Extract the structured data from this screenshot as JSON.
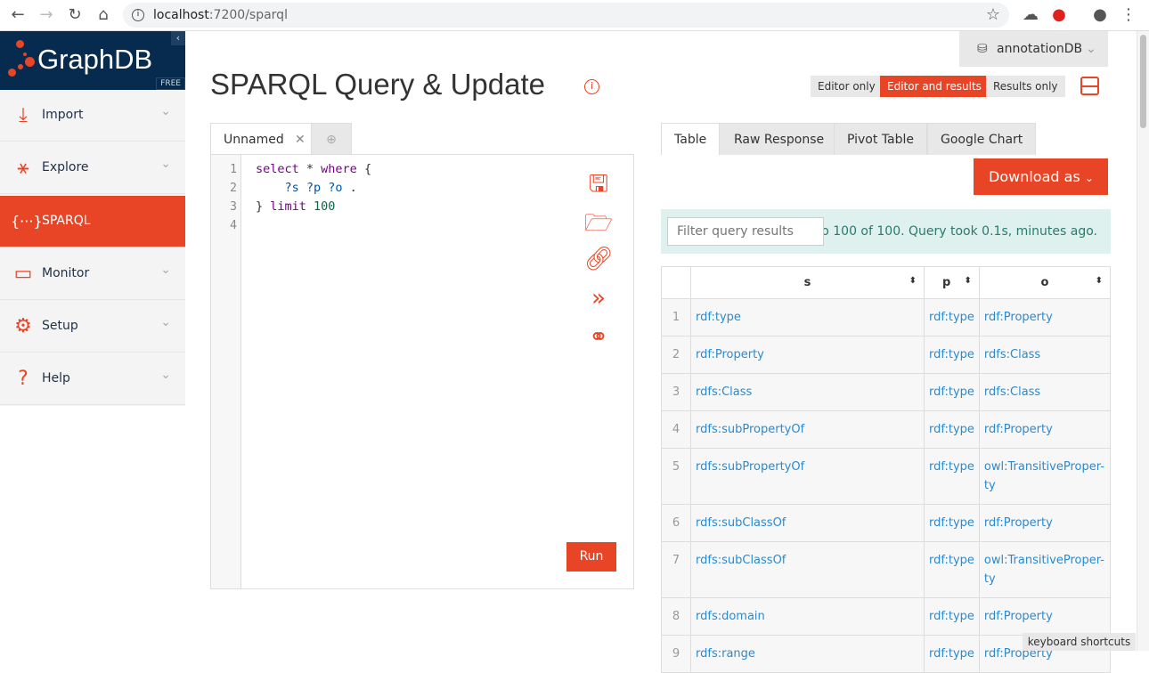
{
  "browser": {
    "url_host": "localhost",
    "url_path": ":7200/sparql"
  },
  "sidebar": {
    "logo": "GraphDB",
    "edition": "FREE",
    "items": [
      {
        "label": "Import",
        "icon": "import-icon"
      },
      {
        "label": "Explore",
        "icon": "explore-icon"
      },
      {
        "label": "SPARQL",
        "icon": "sparql-icon"
      },
      {
        "label": "Monitor",
        "icon": "monitor-icon"
      },
      {
        "label": "Setup",
        "icon": "gear-icon"
      },
      {
        "label": "Help",
        "icon": "help-icon"
      }
    ]
  },
  "header": {
    "title": "SPARQL Query & Update",
    "repository": "annotationDB",
    "modes": [
      "Editor only",
      "Editor and results",
      "Results only"
    ]
  },
  "editor": {
    "tab": "Unnamed",
    "line_numbers": [
      "1",
      "2",
      "3",
      "4"
    ],
    "run_label": "Run"
  },
  "results": {
    "tabs": [
      "Table",
      "Raw Response",
      "Pivot Table",
      "Google Chart"
    ],
    "download_label": "Download as",
    "filter_placeholder": "Filter query results",
    "status": "rom 1 to 100 of 100. Query took 0.1s, minutes ago.",
    "columns": [
      "s",
      "p",
      "o"
    ],
    "rows": [
      [
        "1",
        "rdf:type",
        "rdf:type",
        "rdf:Property"
      ],
      [
        "2",
        "rdf:Property",
        "rdf:type",
        "rdfs:Class"
      ],
      [
        "3",
        "rdfs:Class",
        "rdf:type",
        "rdfs:Class"
      ],
      [
        "4",
        "rdfs:subPropertyOf",
        "rdf:type",
        "rdf:Property"
      ],
      [
        "5",
        "rdfs:subPropertyOf",
        "rdf:type",
        "owl:TransitiveProper-ty"
      ],
      [
        "6",
        "rdfs:subClassOf",
        "rdf:type",
        "rdf:Property"
      ],
      [
        "7",
        "rdfs:subClassOf",
        "rdf:type",
        "owl:TransitiveProper-ty"
      ],
      [
        "8",
        "rdfs:domain",
        "rdf:type",
        "rdf:Property"
      ],
      [
        "9",
        "rdfs:range",
        "rdf:type",
        "rdf:Property"
      ]
    ]
  },
  "footer": {
    "keyboard_shortcuts": "keyboard shortcuts"
  }
}
